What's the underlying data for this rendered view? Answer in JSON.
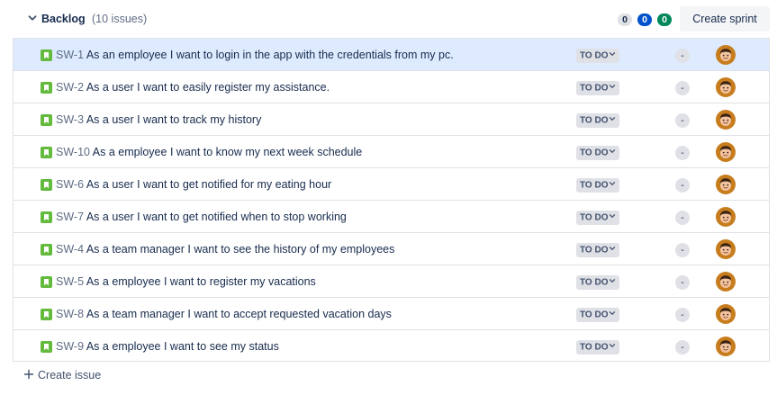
{
  "backlog": {
    "title": "Backlog",
    "count_label": "(10 issues)",
    "status_counts": {
      "todo": "0",
      "in_progress": "0",
      "done": "0"
    },
    "create_sprint_label": "Create sprint"
  },
  "issues": [
    {
      "key": "SW-1",
      "summary": "As an employee I want to login in the app with the credentials from my pc.",
      "status": "TO DO",
      "estimate": "-"
    },
    {
      "key": "SW-2",
      "summary": "As a user I want to easily register my assistance.",
      "status": "TO DO",
      "estimate": "-"
    },
    {
      "key": "SW-3",
      "summary": "As a user I want to track my history",
      "status": "TO DO",
      "estimate": "-"
    },
    {
      "key": "SW-10",
      "summary": "As a employee I want to know my next week schedule",
      "status": "TO DO",
      "estimate": "-"
    },
    {
      "key": "SW-6",
      "summary": "As a user I want to get notified for my eating hour",
      "status": "TO DO",
      "estimate": "-"
    },
    {
      "key": "SW-7",
      "summary": "As a user I want to get notified when to stop working",
      "status": "TO DO",
      "estimate": "-"
    },
    {
      "key": "SW-4",
      "summary": "As a team manager I want to see the history of my employees",
      "status": "TO DO",
      "estimate": "-"
    },
    {
      "key": "SW-5",
      "summary": "As a employee I want to register my vacations",
      "status": "TO DO",
      "estimate": "-"
    },
    {
      "key": "SW-8",
      "summary": "As a team manager I want to accept requested vacation days",
      "status": "TO DO",
      "estimate": "-"
    },
    {
      "key": "SW-9",
      "summary": "As a employee I want to see my status",
      "status": "TO DO",
      "estimate": "-"
    }
  ],
  "footer": {
    "create_issue_label": "Create issue"
  },
  "colors": {
    "story_icon": "#63ba3c",
    "selected_row": "#deebff",
    "in_progress_badge": "#0052cc",
    "done_badge": "#00875a",
    "avatar_bg": "#c77d1e"
  },
  "icons": {
    "collapse": "chevron-down-icon",
    "issue_type": "story-icon",
    "status_dropdown": "chevron-down-icon",
    "assignee": "avatar",
    "create": "plus-icon"
  }
}
